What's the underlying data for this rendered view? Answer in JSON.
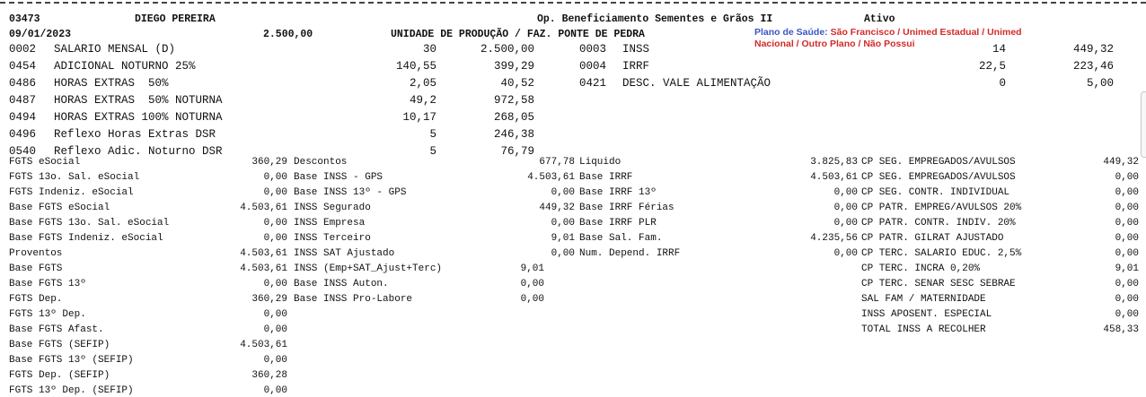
{
  "header": {
    "employee_id": "03473",
    "employee_name": "DIEGO PEREIRA",
    "department": "Op. Beneficiamento Sementes e Grãos II",
    "status": "Ativo",
    "admission_date": "09/01/2023",
    "salary": "2.500,00",
    "unit": "UNIDADE DE PRODUÇÃO / FAZ. PONTE DE PEDRA",
    "health_plan_label": "Plano de Saúde:",
    "health_plan_options_line1": "São Francisco / Unimed Estadual / Unimed",
    "health_plan_options_line2": "Nacional / Outro Plano / Não Possui"
  },
  "earnings": [
    {
      "code": "0002",
      "desc": "SALARIO MENSAL (D)",
      "ref": "30",
      "value": "2.500,00"
    },
    {
      "code": "0454",
      "desc": "ADICIONAL NOTURNO 25%",
      "ref": "140,55",
      "value": "399,29"
    },
    {
      "code": "0486",
      "desc": "HORAS EXTRAS  50%",
      "ref": "2,05",
      "value": "40,52"
    },
    {
      "code": "0487",
      "desc": "HORAS EXTRAS  50% NOTURNA",
      "ref": "49,2",
      "value": "972,58"
    },
    {
      "code": "0494",
      "desc": "HORAS EXTRAS 100% NOTURNA",
      "ref": "10,17",
      "value": "268,05"
    },
    {
      "code": "0496",
      "desc": "Reflexo Horas Extras DSR",
      "ref": "5",
      "value": "246,38"
    },
    {
      "code": "0540",
      "desc": "Reflexo Adic. Noturno DSR",
      "ref": "5",
      "value": "76,79"
    }
  ],
  "deductions": [
    {
      "code": "0003",
      "desc": "INSS",
      "ref": "14",
      "value": "449,32"
    },
    {
      "code": "0004",
      "desc": "IRRF",
      "ref": "22,5",
      "value": "223,46"
    },
    {
      "code": "0421",
      "desc": "DESC. VALE ALIMENTAÇÃO",
      "ref": "0",
      "value": "5,00"
    }
  ],
  "summary": {
    "col1": [
      {
        "label": "FGTS eSocial",
        "value": "360,29"
      },
      {
        "label": "FGTS 13o. Sal. eSocial",
        "value": "0,00"
      },
      {
        "label": "FGTS Indeniz. eSocial",
        "value": "0,00"
      },
      {
        "label": "Base FGTS eSocial",
        "value": "4.503,61"
      },
      {
        "label": "Base FGTS 13o. Sal. eSocial",
        "value": "0,00"
      },
      {
        "label": "Base FGTS Indeniz. eSocial",
        "value": "0,00"
      },
      {
        "label": "Proventos",
        "value": "4.503,61"
      },
      {
        "label": "Base FGTS",
        "value": "4.503,61"
      },
      {
        "label": "Base FGTS 13º",
        "value": "0,00"
      },
      {
        "label": "FGTS Dep.",
        "value": "360,29"
      },
      {
        "label": "FGTS 13º Dep.",
        "value": "0,00"
      },
      {
        "label": "Base FGTS Afast.",
        "value": "0,00"
      },
      {
        "label": "Base FGTS (SEFIP)",
        "value": "4.503,61"
      },
      {
        "label": "Base FGTS 13º (SEFIP)",
        "value": "0,00"
      },
      {
        "label": "FGTS Dep. (SEFIP)",
        "value": "360,28"
      },
      {
        "label": "FGTS 13º Dep. (SEFIP)",
        "value": "0,00"
      }
    ],
    "col2": [
      {
        "label": "Descontos",
        "value": "677,78"
      },
      {
        "label": "Base INSS - GPS",
        "value": "4.503,61"
      },
      {
        "label": "Base INSS 13º - GPS",
        "value": "0,00"
      },
      {
        "label": "INSS Segurado",
        "value": "449,32"
      },
      {
        "label": "INSS Empresa",
        "value": "0,00"
      },
      {
        "label": "INSS Terceiro",
        "value": "9,01"
      },
      {
        "label": "INSS SAT Ajustado",
        "value": "0,00"
      },
      {
        "label": "INSS (Emp+SAT_Ajust+Terc)",
        "value": "9,01"
      },
      {
        "label": "Base INSS Auton.",
        "value": "0,00"
      },
      {
        "label": "Base INSS Pro-Labore",
        "value": "0,00"
      }
    ],
    "col3": [
      {
        "label": "Liquido",
        "value": "3.825,83"
      },
      {
        "label": "Base IRRF",
        "value": "4.503,61"
      },
      {
        "label": "Base IRRF 13º",
        "value": "0,00"
      },
      {
        "label": "Base IRRF Férias",
        "value": "0,00"
      },
      {
        "label": "Base IRRF PLR",
        "value": "0,00"
      },
      {
        "label": "Base Sal. Fam.",
        "value": "4.235,56"
      },
      {
        "label": "Num. Depend. IRRF",
        "value": "0,00"
      }
    ],
    "col4": [
      {
        "label": "CP SEG. EMPREGADOS/AVULSOS",
        "value": "449,32"
      },
      {
        "label": "CP SEG. EMPREGADOS/AVULSOS",
        "value": "0,00"
      },
      {
        "label": "CP SEG. CONTR. INDIVIDUAL",
        "value": "0,00"
      },
      {
        "label": "CP PATR. EMPREG/AVULSOS 20%",
        "value": "0,00"
      },
      {
        "label": "CP PATR. CONTR. INDIV. 20%",
        "value": "0,00"
      },
      {
        "label": "CP PATR. GILRAT AJUSTADO",
        "value": "0,00"
      },
      {
        "label": "CP TERC. SALARIO EDUC. 2,5%",
        "value": "0,00"
      },
      {
        "label": "CP TERC. INCRA 0,20%",
        "value": "9,01"
      },
      {
        "label": "CP TERC. SENAR SESC SEBRAE",
        "value": "0,00"
      },
      {
        "label": "SAL FAM / MATERNIDADE",
        "value": "0,00"
      },
      {
        "label": "INSS APOSENT. ESPECIAL",
        "value": "0,00"
      },
      {
        "label": "TOTAL INSS A RECOLHER",
        "value": "458,33"
      }
    ]
  }
}
